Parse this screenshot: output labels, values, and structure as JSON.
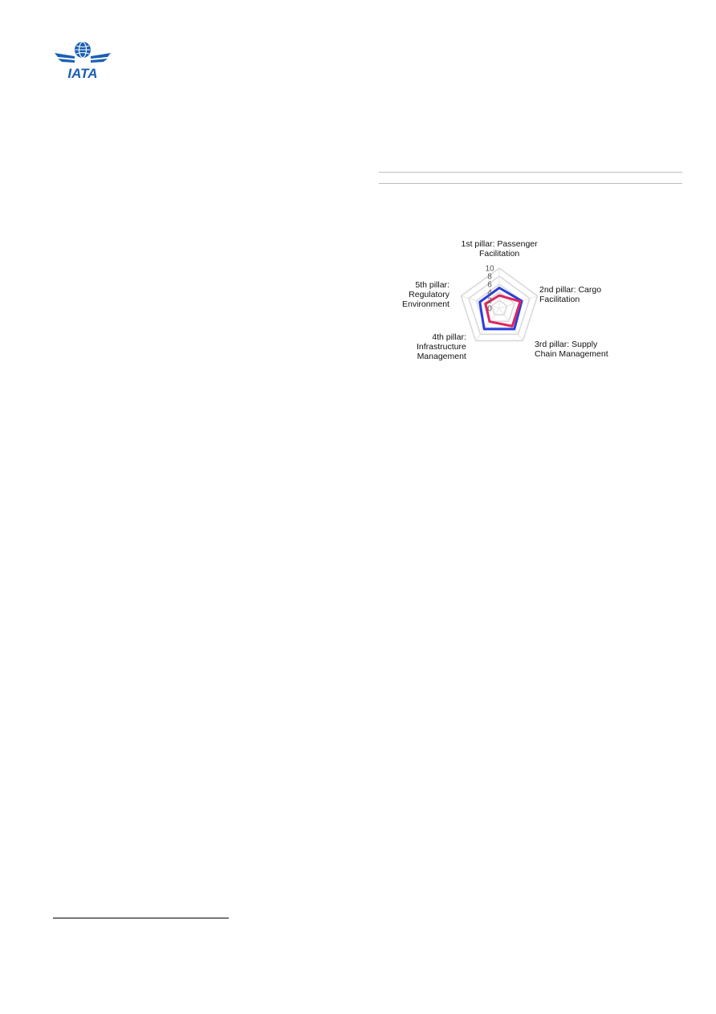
{
  "header": {
    "logo": {
      "icon": "iata-globe-wings-icon",
      "text": "IATA",
      "color": "#1a5fb4"
    }
  },
  "chart_data": {
    "type": "radar",
    "axes": [
      "1st pillar: Passenger Facilitation",
      "2nd pillar: Cargo Facilitation",
      "3rd pillar: Supply Chain Management",
      "4th pillar: Infrastructure Management",
      "5th pillar: Regulatory Environment"
    ],
    "axis_label_lines": [
      [
        "1st pillar: Passenger",
        "Facilitation"
      ],
      [
        "2nd pillar: Cargo",
        "Facilitation"
      ],
      [
        "3rd pillar: Supply",
        "Chain Management"
      ],
      [
        "4th pillar:",
        "Infrastructure",
        "Management"
      ],
      [
        "5th pillar:",
        "Regulatory",
        "Environment"
      ]
    ],
    "rlim": [
      0,
      10
    ],
    "ticks": [
      "0",
      "2",
      "4",
      "6",
      "8",
      "10"
    ],
    "grid": true,
    "series": [
      {
        "color": "#2b3fd9",
        "values": [
          5.1,
          5.9,
          6.4,
          6.4,
          5.1
        ]
      },
      {
        "color": "#e0245e",
        "values": [
          3.2,
          5.5,
          5.5,
          4.1,
          3.6
        ]
      }
    ]
  }
}
